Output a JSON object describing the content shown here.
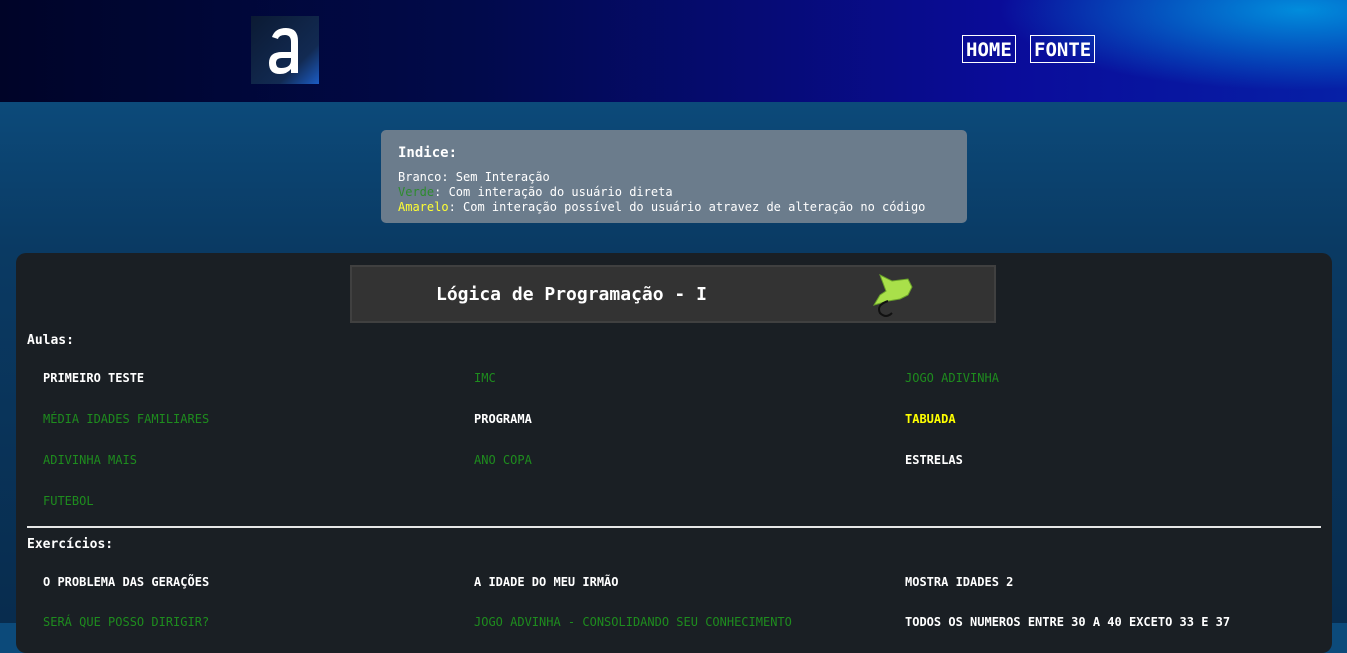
{
  "header": {
    "nav": [
      {
        "label": "HOME"
      },
      {
        "label": "FONTE"
      }
    ]
  },
  "index": {
    "title": "Indice:",
    "legend": [
      {
        "key": "Branco",
        "desc": ": Sem Interação",
        "color": "#ffffff"
      },
      {
        "key": "Verde",
        "desc": ": Com interação do usuário direta",
        "color": "#2e8b2e"
      },
      {
        "key": "Amarelo",
        "desc": ": Com interação possível do usuário atravez de alteração no código",
        "color": "#ffff33"
      }
    ]
  },
  "course": {
    "title": "Lógica de Programação - I"
  },
  "aulas": {
    "title": "Aulas:",
    "items": [
      {
        "label": "PRIMEIRO TESTE",
        "type": "white"
      },
      {
        "label": "IMC",
        "type": "green"
      },
      {
        "label": "JOGO ADIVINHA",
        "type": "green"
      },
      {
        "label": "MÉDIA IDADES FAMILIARES",
        "type": "green"
      },
      {
        "label": "PROGRAMA",
        "type": "white"
      },
      {
        "label": "TABUADA",
        "type": "yellow"
      },
      {
        "label": "ADIVINHA MAIS",
        "type": "green"
      },
      {
        "label": "ANO COPA",
        "type": "green"
      },
      {
        "label": "ESTRELAS",
        "type": "white"
      },
      {
        "label": "FUTEBOL",
        "type": "green"
      }
    ]
  },
  "exercicios": {
    "title": "Exercícios:",
    "items": [
      {
        "label": "O PROBLEMA DAS GERAÇÕES",
        "type": "white"
      },
      {
        "label": "A IDADE DO MEU IRMÃO",
        "type": "white"
      },
      {
        "label": "MOSTRA IDADES 2",
        "type": "white"
      },
      {
        "label": "SERÁ QUE POSSO DIRIGIR?",
        "type": "green"
      },
      {
        "label": "JOGO ADVINHA - CONSOLIDANDO SEU CONHECIMENTO",
        "type": "green"
      },
      {
        "label": "TODOS OS NUMEROS ENTRE 30 A 40 EXCETO 33 E 37",
        "type": "white"
      }
    ]
  },
  "colors": {
    "white": "#ffffff",
    "green": "#1e8c1e",
    "yellow": "#ffff00",
    "panel": "#1a1f24"
  },
  "icons": {
    "logo": "letter-a-logo",
    "decoration": "green-puzzle-icon"
  }
}
